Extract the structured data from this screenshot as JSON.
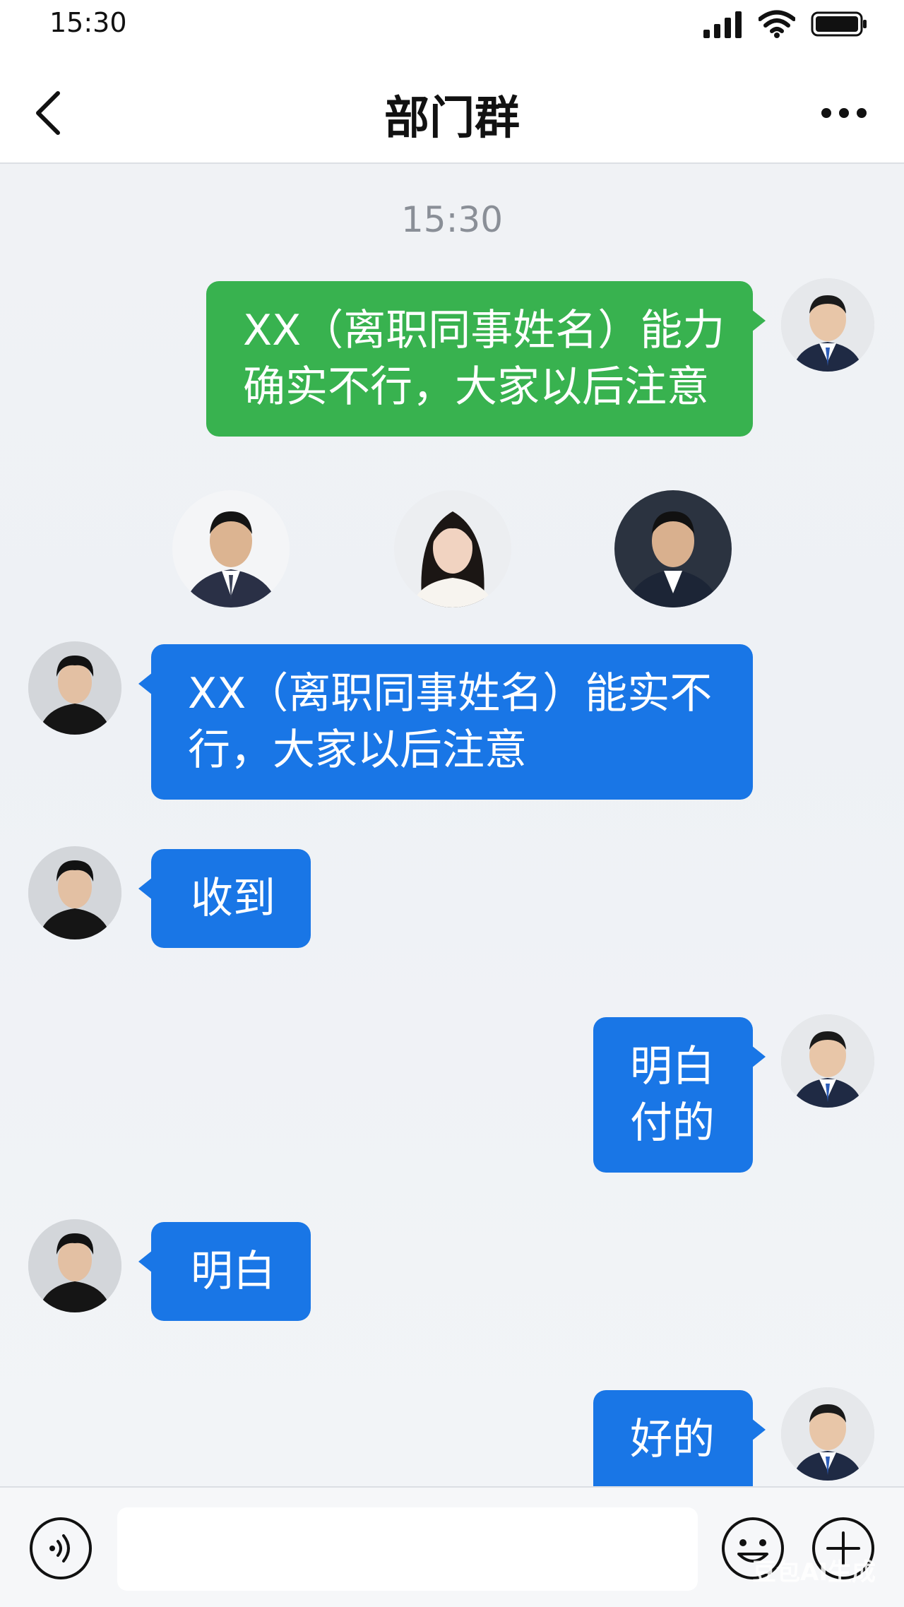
{
  "status_bar": {
    "time": "15:30"
  },
  "header": {
    "title": "部门群"
  },
  "chat": {
    "timestamp": "15:30",
    "messages": [
      {
        "sender": "self",
        "lines": [
          "XX（离职同事姓名）能力",
          "确实不行，大家以后注意"
        ]
      },
      {
        "sender": "colleague",
        "lines": [
          "XX（离职同事姓名）能实不",
          "行，大家以后注意"
        ]
      },
      {
        "sender": "colleague",
        "lines": [
          "收到"
        ]
      },
      {
        "sender": "self",
        "lines": [
          "明白",
          "付的"
        ]
      },
      {
        "sender": "colleague",
        "lines": [
          "明白"
        ]
      },
      {
        "sender": "self",
        "lines": [
          "好的"
        ]
      }
    ]
  },
  "input_bar": {
    "placeholder": ""
  },
  "watermark": "豆包AI生成",
  "colors": {
    "self_bubble": "#38b24f",
    "reply_bubble": "#1976e6",
    "background": "#eef1f5"
  }
}
